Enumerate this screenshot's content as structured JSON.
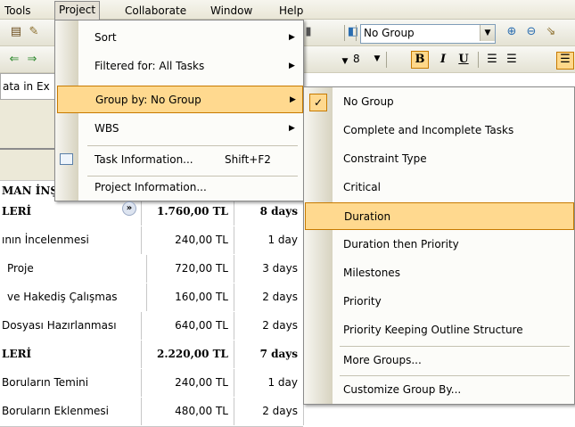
{
  "menubar": {
    "items": [
      {
        "label": "Tools"
      },
      {
        "label": "Project"
      },
      {
        "label": "Collaborate"
      },
      {
        "label": "Window"
      },
      {
        "label": "Help"
      }
    ]
  },
  "toolbar": {
    "group_combo_value": "No Group",
    "font_size_value": "8",
    "bold_label": "B",
    "italic_label": "I",
    "underline_label": "U"
  },
  "entry_bar_text": "ata in Ex",
  "project_menu": {
    "items": [
      {
        "label": "Sort",
        "shortcut": "",
        "submenu": true
      },
      {
        "label": "Filtered for: All Tasks",
        "shortcut": "",
        "submenu": true
      },
      {
        "label": "Group by: No Group",
        "shortcut": "",
        "submenu": true
      },
      {
        "label": "WBS",
        "shortcut": "",
        "submenu": true
      },
      {
        "label": "Task Information...",
        "shortcut": "Shift+F2",
        "submenu": false
      },
      {
        "label": "Project Information...",
        "shortcut": "",
        "submenu": false
      }
    ],
    "expand_glyph": "»"
  },
  "group_submenu": {
    "checked_glyph": "✓",
    "items": [
      {
        "label": "No Group"
      },
      {
        "label": "Complete and Incomplete Tasks"
      },
      {
        "label": "Constraint Type"
      },
      {
        "label": "Critical"
      },
      {
        "label": "Duration"
      },
      {
        "label": "Duration then Priority"
      },
      {
        "label": "Milestones"
      },
      {
        "label": "Priority"
      },
      {
        "label": "Priority Keeping Outline Structure"
      },
      {
        "label": "More Groups..."
      },
      {
        "label": "Customize Group By..."
      }
    ]
  },
  "table": {
    "partial_header": "MAN İNŞ",
    "rows": [
      {
        "name": "LERİ",
        "cost": "1.760,00 TL",
        "duration": "8 days",
        "summary": true
      },
      {
        "name": "ının İncelenmesi",
        "cost": "240,00 TL",
        "duration": "1 day",
        "summary": false
      },
      {
        "name": "Proje",
        "cost": "720,00 TL",
        "duration": "3 days",
        "summary": false
      },
      {
        "name": "ve Hakediş Çalışmas",
        "cost": "160,00 TL",
        "duration": "2 days",
        "summary": false
      },
      {
        "name": "Dosyası Hazırlanması",
        "cost": "640,00 TL",
        "duration": "2 days",
        "summary": false
      },
      {
        "name": "LERİ",
        "cost": "2.220,00 TL",
        "duration": "7 days",
        "summary": true
      },
      {
        "name": "Boruların Temini",
        "cost": "240,00 TL",
        "duration": "1 day",
        "summary": false
      },
      {
        "name": "Boruların Eklenmesi",
        "cost": "480,00 TL",
        "duration": "2 days",
        "summary": false
      }
    ]
  },
  "colors": {
    "highlight": "#ffd98f",
    "highlight_border": "#c77a00",
    "menu_background": "#fcfcf9"
  }
}
